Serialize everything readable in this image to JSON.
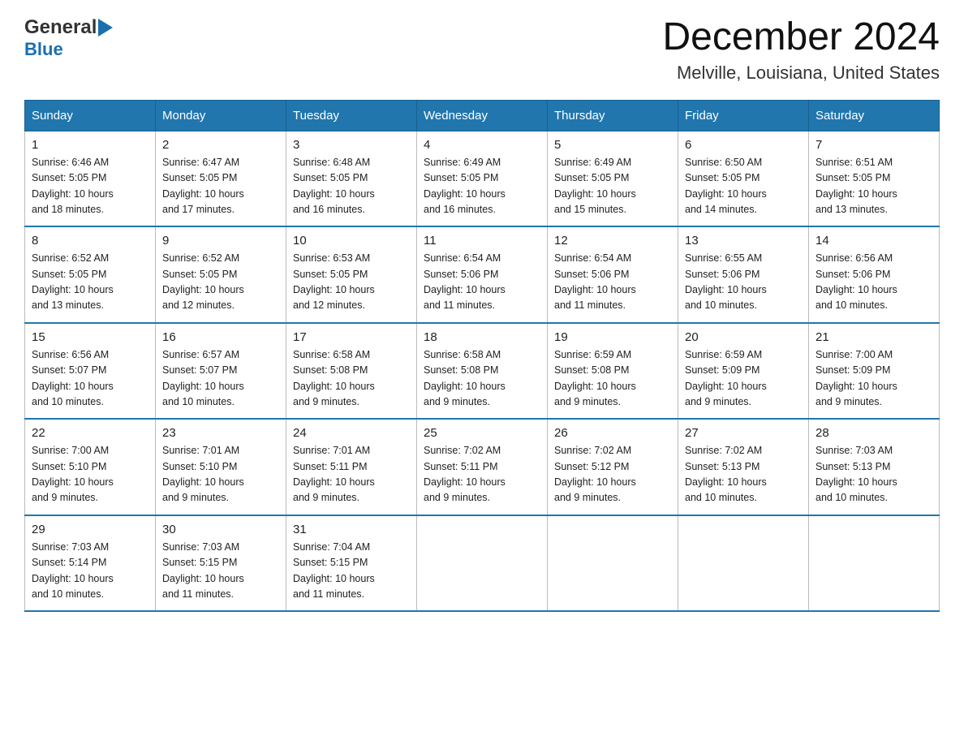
{
  "header": {
    "logo_general": "General",
    "logo_blue": "Blue",
    "month": "December 2024",
    "location": "Melville, Louisiana, United States"
  },
  "days_of_week": [
    "Sunday",
    "Monday",
    "Tuesday",
    "Wednesday",
    "Thursday",
    "Friday",
    "Saturday"
  ],
  "weeks": [
    [
      {
        "day": "1",
        "sunrise": "6:46 AM",
        "sunset": "5:05 PM",
        "daylight": "10 hours and 18 minutes."
      },
      {
        "day": "2",
        "sunrise": "6:47 AM",
        "sunset": "5:05 PM",
        "daylight": "10 hours and 17 minutes."
      },
      {
        "day": "3",
        "sunrise": "6:48 AM",
        "sunset": "5:05 PM",
        "daylight": "10 hours and 16 minutes."
      },
      {
        "day": "4",
        "sunrise": "6:49 AM",
        "sunset": "5:05 PM",
        "daylight": "10 hours and 16 minutes."
      },
      {
        "day": "5",
        "sunrise": "6:49 AM",
        "sunset": "5:05 PM",
        "daylight": "10 hours and 15 minutes."
      },
      {
        "day": "6",
        "sunrise": "6:50 AM",
        "sunset": "5:05 PM",
        "daylight": "10 hours and 14 minutes."
      },
      {
        "day": "7",
        "sunrise": "6:51 AM",
        "sunset": "5:05 PM",
        "daylight": "10 hours and 13 minutes."
      }
    ],
    [
      {
        "day": "8",
        "sunrise": "6:52 AM",
        "sunset": "5:05 PM",
        "daylight": "10 hours and 13 minutes."
      },
      {
        "day": "9",
        "sunrise": "6:52 AM",
        "sunset": "5:05 PM",
        "daylight": "10 hours and 12 minutes."
      },
      {
        "day": "10",
        "sunrise": "6:53 AM",
        "sunset": "5:05 PM",
        "daylight": "10 hours and 12 minutes."
      },
      {
        "day": "11",
        "sunrise": "6:54 AM",
        "sunset": "5:06 PM",
        "daylight": "10 hours and 11 minutes."
      },
      {
        "day": "12",
        "sunrise": "6:54 AM",
        "sunset": "5:06 PM",
        "daylight": "10 hours and 11 minutes."
      },
      {
        "day": "13",
        "sunrise": "6:55 AM",
        "sunset": "5:06 PM",
        "daylight": "10 hours and 10 minutes."
      },
      {
        "day": "14",
        "sunrise": "6:56 AM",
        "sunset": "5:06 PM",
        "daylight": "10 hours and 10 minutes."
      }
    ],
    [
      {
        "day": "15",
        "sunrise": "6:56 AM",
        "sunset": "5:07 PM",
        "daylight": "10 hours and 10 minutes."
      },
      {
        "day": "16",
        "sunrise": "6:57 AM",
        "sunset": "5:07 PM",
        "daylight": "10 hours and 10 minutes."
      },
      {
        "day": "17",
        "sunrise": "6:58 AM",
        "sunset": "5:08 PM",
        "daylight": "10 hours and 9 minutes."
      },
      {
        "day": "18",
        "sunrise": "6:58 AM",
        "sunset": "5:08 PM",
        "daylight": "10 hours and 9 minutes."
      },
      {
        "day": "19",
        "sunrise": "6:59 AM",
        "sunset": "5:08 PM",
        "daylight": "10 hours and 9 minutes."
      },
      {
        "day": "20",
        "sunrise": "6:59 AM",
        "sunset": "5:09 PM",
        "daylight": "10 hours and 9 minutes."
      },
      {
        "day": "21",
        "sunrise": "7:00 AM",
        "sunset": "5:09 PM",
        "daylight": "10 hours and 9 minutes."
      }
    ],
    [
      {
        "day": "22",
        "sunrise": "7:00 AM",
        "sunset": "5:10 PM",
        "daylight": "10 hours and 9 minutes."
      },
      {
        "day": "23",
        "sunrise": "7:01 AM",
        "sunset": "5:10 PM",
        "daylight": "10 hours and 9 minutes."
      },
      {
        "day": "24",
        "sunrise": "7:01 AM",
        "sunset": "5:11 PM",
        "daylight": "10 hours and 9 minutes."
      },
      {
        "day": "25",
        "sunrise": "7:02 AM",
        "sunset": "5:11 PM",
        "daylight": "10 hours and 9 minutes."
      },
      {
        "day": "26",
        "sunrise": "7:02 AM",
        "sunset": "5:12 PM",
        "daylight": "10 hours and 9 minutes."
      },
      {
        "day": "27",
        "sunrise": "7:02 AM",
        "sunset": "5:13 PM",
        "daylight": "10 hours and 10 minutes."
      },
      {
        "day": "28",
        "sunrise": "7:03 AM",
        "sunset": "5:13 PM",
        "daylight": "10 hours and 10 minutes."
      }
    ],
    [
      {
        "day": "29",
        "sunrise": "7:03 AM",
        "sunset": "5:14 PM",
        "daylight": "10 hours and 10 minutes."
      },
      {
        "day": "30",
        "sunrise": "7:03 AM",
        "sunset": "5:15 PM",
        "daylight": "10 hours and 11 minutes."
      },
      {
        "day": "31",
        "sunrise": "7:04 AM",
        "sunset": "5:15 PM",
        "daylight": "10 hours and 11 minutes."
      },
      null,
      null,
      null,
      null
    ]
  ],
  "labels": {
    "sunrise": "Sunrise:",
    "sunset": "Sunset:",
    "daylight": "Daylight:"
  }
}
